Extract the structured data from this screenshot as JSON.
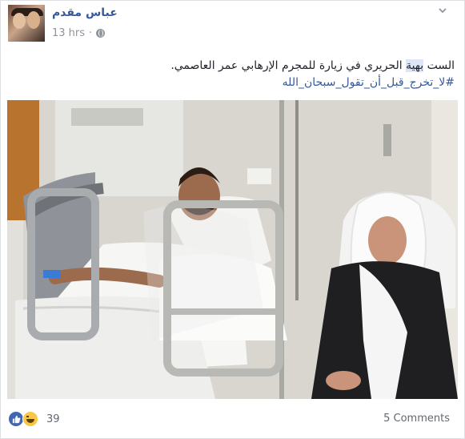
{
  "post": {
    "author": "عباس مقدم",
    "time": "13 hrs",
    "text_before": "الست ",
    "text_highlight": "بهية",
    "text_after": " الحريري في زيارة للمجرم الإرهابي عمر العاصمي.",
    "hashtag": "#لا_تخرج_قبل_أن_تقول_سبحان_الله",
    "reactions_count": "39",
    "comments_label": "5 Comments"
  },
  "icons": {
    "privacy": "globe-icon",
    "menu": "chevron-down-icon",
    "reaction1": "like-icon",
    "reaction2": "haha-icon"
  },
  "colors": {
    "link": "#365899",
    "meta": "#90949c",
    "like": "#4267b2",
    "highlight": "#dce6f8"
  }
}
